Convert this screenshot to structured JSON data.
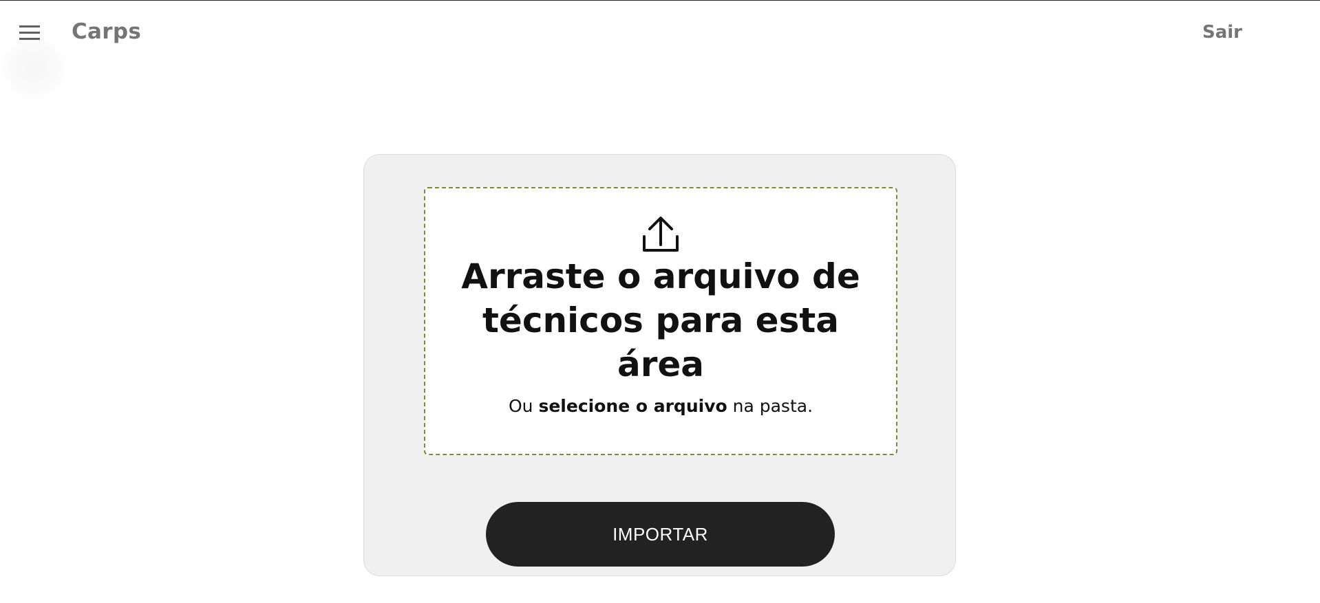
{
  "header": {
    "app_title": "Carps",
    "logout_label": "Sair",
    "menu_icon": "hamburger-menu-icon"
  },
  "upload": {
    "icon": "upload-icon",
    "title": "Arraste o arquivo de técnicos para esta área",
    "subtitle_prefix": "Ou ",
    "subtitle_link": "selecione o arquivo",
    "subtitle_suffix": " na pasta.",
    "border_color": "#7a8a3a"
  },
  "actions": {
    "import_label": "IMPORTAR",
    "button_color": "#222222"
  }
}
